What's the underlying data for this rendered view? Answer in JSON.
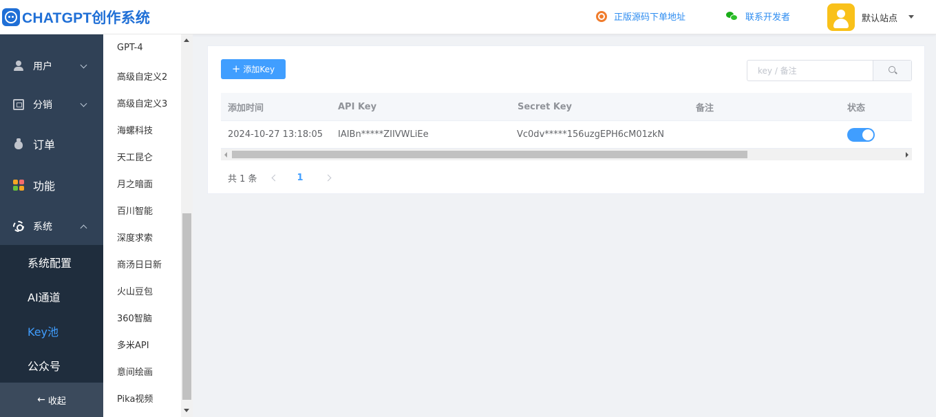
{
  "header": {
    "app_title": "CHATGPT创作系统",
    "source_link": "正版源码下单地址",
    "contact_link": "联系开发者",
    "user_name": "默认站点"
  },
  "sidebar": {
    "items": [
      {
        "label": "用户",
        "icon": "user-icon"
      },
      {
        "label": "分销",
        "icon": "distribution-icon"
      },
      {
        "label": "订单",
        "icon": "money-bag-icon"
      },
      {
        "label": "功能",
        "icon": "apps-grid-icon"
      },
      {
        "label": "系统",
        "icon": "gear-icon"
      }
    ],
    "submenu": [
      {
        "label": "系统配置"
      },
      {
        "label": "AI通道"
      },
      {
        "label": "Key池"
      },
      {
        "label": "公众号"
      }
    ],
    "collapse_label": "收起"
  },
  "channels": {
    "items": [
      "GPT-4",
      "高级自定义2",
      "高级自定义3",
      "海螺科技",
      "天工昆仑",
      "月之暗面",
      "百川智能",
      "深度求索",
      "商汤日日新",
      "火山豆包",
      "360智脑",
      "多米API",
      "意间绘画",
      "Pika视频"
    ]
  },
  "main": {
    "add_button": "添加Key",
    "search_placeholder": "key / 备注",
    "table": {
      "headers": [
        "添加时间",
        "API Key",
        "Secret Key",
        "备注",
        "状态"
      ],
      "rows": [
        {
          "time": "2024-10-27 13:18:05",
          "api_key": "IAIBn*****ZIIVWLiEe",
          "secret_key": "Vc0dv*****156uzgEPH6cM01zkN",
          "remark": "",
          "status": true
        }
      ]
    },
    "pagination": {
      "total_text": "共 1 条",
      "current_page": "1"
    }
  },
  "colors": {
    "brand": "#1f6fd6",
    "accent": "#409eff",
    "sidebar": "#304156",
    "submenu": "#1f2d3d"
  }
}
